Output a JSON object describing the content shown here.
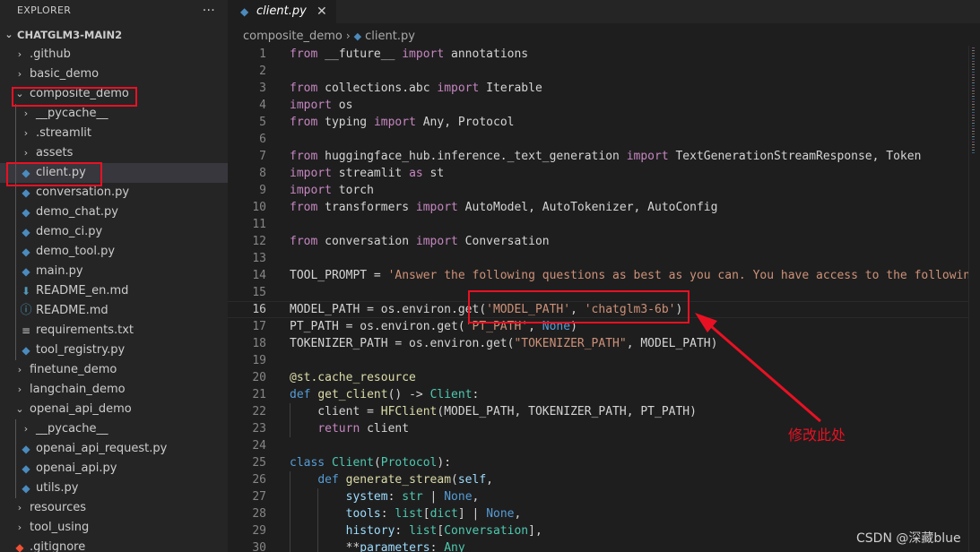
{
  "sidebar": {
    "title": "EXPLORER",
    "more": "···",
    "project": "CHATGLM3-MAIN2",
    "items": [
      {
        "label": ".github",
        "type": "folder",
        "depth": 0,
        "open": false
      },
      {
        "label": "basic_demo",
        "type": "folder",
        "depth": 0,
        "open": false
      },
      {
        "label": "composite_demo",
        "type": "folder",
        "depth": 0,
        "open": true
      },
      {
        "label": "__pycache__",
        "type": "folder",
        "depth": 1,
        "open": false
      },
      {
        "label": ".streamlit",
        "type": "folder",
        "depth": 1,
        "open": false
      },
      {
        "label": "assets",
        "type": "folder",
        "depth": 1,
        "open": false
      },
      {
        "label": "client.py",
        "type": "py",
        "depth": 1,
        "selected": true
      },
      {
        "label": "conversation.py",
        "type": "py",
        "depth": 1
      },
      {
        "label": "demo_chat.py",
        "type": "py",
        "depth": 1
      },
      {
        "label": "demo_ci.py",
        "type": "py",
        "depth": 1
      },
      {
        "label": "demo_tool.py",
        "type": "py",
        "depth": 1
      },
      {
        "label": "main.py",
        "type": "py",
        "depth": 1
      },
      {
        "label": "README_en.md",
        "type": "md",
        "depth": 1
      },
      {
        "label": "README.md",
        "type": "info",
        "depth": 1
      },
      {
        "label": "requirements.txt",
        "type": "txt",
        "depth": 1
      },
      {
        "label": "tool_registry.py",
        "type": "py",
        "depth": 1
      },
      {
        "label": "finetune_demo",
        "type": "folder",
        "depth": 0,
        "open": false
      },
      {
        "label": "langchain_demo",
        "type": "folder",
        "depth": 0,
        "open": false
      },
      {
        "label": "openai_api_demo",
        "type": "folder",
        "depth": 0,
        "open": true
      },
      {
        "label": "__pycache__",
        "type": "folder",
        "depth": 1,
        "open": false
      },
      {
        "label": "openai_api_request.py",
        "type": "py",
        "depth": 1
      },
      {
        "label": "openai_api.py",
        "type": "py",
        "depth": 1
      },
      {
        "label": "utils.py",
        "type": "py",
        "depth": 1
      },
      {
        "label": "resources",
        "type": "folder",
        "depth": 0,
        "open": false
      },
      {
        "label": "tool_using",
        "type": "folder",
        "depth": 0,
        "open": false
      },
      {
        "label": ".gitignore",
        "type": "git",
        "depth": 0
      }
    ]
  },
  "tab": {
    "label": "client.py",
    "close": "✕"
  },
  "breadcrumb": {
    "folder": "composite_demo",
    "file": "client.py"
  },
  "editor": {
    "current_line": 16,
    "lines": [
      {
        "n": 1,
        "t": [
          [
            "kw",
            "from"
          ],
          [
            "plain",
            " __future__ "
          ],
          [
            "kw",
            "import"
          ],
          [
            "plain",
            " annotations"
          ]
        ]
      },
      {
        "n": 2,
        "t": []
      },
      {
        "n": 3,
        "t": [
          [
            "kw",
            "from"
          ],
          [
            "plain",
            " collections.abc "
          ],
          [
            "kw",
            "import"
          ],
          [
            "plain",
            " Iterable"
          ]
        ]
      },
      {
        "n": 4,
        "t": [
          [
            "kw",
            "import"
          ],
          [
            "plain",
            " os"
          ]
        ]
      },
      {
        "n": 5,
        "t": [
          [
            "kw",
            "from"
          ],
          [
            "plain",
            " typing "
          ],
          [
            "kw",
            "import"
          ],
          [
            "plain",
            " Any, Protocol"
          ]
        ]
      },
      {
        "n": 6,
        "t": []
      },
      {
        "n": 7,
        "t": [
          [
            "kw",
            "from"
          ],
          [
            "plain",
            " huggingface_hub.inference._text_generation "
          ],
          [
            "kw",
            "import"
          ],
          [
            "plain",
            " TextGenerationStreamResponse, Token"
          ]
        ]
      },
      {
        "n": 8,
        "t": [
          [
            "kw",
            "import"
          ],
          [
            "plain",
            " streamlit "
          ],
          [
            "kw",
            "as"
          ],
          [
            "plain",
            " st"
          ]
        ]
      },
      {
        "n": 9,
        "t": [
          [
            "kw",
            "import"
          ],
          [
            "plain",
            " torch"
          ]
        ]
      },
      {
        "n": 10,
        "t": [
          [
            "kw",
            "from"
          ],
          [
            "plain",
            " transformers "
          ],
          [
            "kw",
            "import"
          ],
          [
            "plain",
            " AutoModel, AutoTokenizer, AutoConfig"
          ]
        ]
      },
      {
        "n": 11,
        "t": []
      },
      {
        "n": 12,
        "t": [
          [
            "kw",
            "from"
          ],
          [
            "plain",
            " conversation "
          ],
          [
            "kw",
            "import"
          ],
          [
            "plain",
            " Conversation"
          ]
        ]
      },
      {
        "n": 13,
        "t": []
      },
      {
        "n": 14,
        "t": [
          [
            "plain",
            "TOOL_PROMPT = "
          ],
          [
            "str",
            "'Answer the following questions as best as you can. You have access to the following tools:'"
          ]
        ]
      },
      {
        "n": 15,
        "t": []
      },
      {
        "n": 16,
        "t": [
          [
            "plain",
            "MODEL_PATH = os.environ.get("
          ],
          [
            "str",
            "'MODEL_PATH'"
          ],
          [
            "plain",
            ", "
          ],
          [
            "str",
            "'chatglm3-6b'"
          ],
          [
            "plain",
            ")"
          ]
        ]
      },
      {
        "n": 17,
        "t": [
          [
            "plain",
            "PT_PATH = os.environ.get("
          ],
          [
            "str",
            "'PT_PATH'"
          ],
          [
            "plain",
            ", "
          ],
          [
            "kb",
            "None"
          ],
          [
            "plain",
            ")"
          ]
        ]
      },
      {
        "n": 18,
        "t": [
          [
            "plain",
            "TOKENIZER_PATH = os.environ.get("
          ],
          [
            "str",
            "\"TOKENIZER_PATH\""
          ],
          [
            "plain",
            ", MODEL_PATH)"
          ]
        ]
      },
      {
        "n": 19,
        "t": []
      },
      {
        "n": 20,
        "t": [
          [
            "fn",
            "@st.cache_resource"
          ]
        ]
      },
      {
        "n": 21,
        "t": [
          [
            "kb",
            "def"
          ],
          [
            "plain",
            " "
          ],
          [
            "fn",
            "get_client"
          ],
          [
            "plain",
            "() -> "
          ],
          [
            "cls",
            "Client"
          ],
          [
            "plain",
            ":"
          ]
        ]
      },
      {
        "n": 22,
        "t": [
          [
            "plain",
            "    client = "
          ],
          [
            "fn",
            "HFClient"
          ],
          [
            "plain",
            "(MODEL_PATH, TOKENIZER_PATH, PT_PATH)"
          ]
        ]
      },
      {
        "n": 23,
        "t": [
          [
            "plain",
            "    "
          ],
          [
            "kw",
            "return"
          ],
          [
            "plain",
            " client"
          ]
        ]
      },
      {
        "n": 24,
        "t": []
      },
      {
        "n": 25,
        "t": [
          [
            "kb",
            "class"
          ],
          [
            "plain",
            " "
          ],
          [
            "cls",
            "Client"
          ],
          [
            "plain",
            "("
          ],
          [
            "cls",
            "Protocol"
          ],
          [
            "plain",
            "):"
          ]
        ]
      },
      {
        "n": 26,
        "t": [
          [
            "plain",
            "    "
          ],
          [
            "kb",
            "def"
          ],
          [
            "plain",
            " "
          ],
          [
            "fn",
            "generate_stream"
          ],
          [
            "plain",
            "("
          ],
          [
            "var",
            "self"
          ],
          [
            "plain",
            ","
          ]
        ]
      },
      {
        "n": 27,
        "t": [
          [
            "plain",
            "        "
          ],
          [
            "var",
            "system"
          ],
          [
            "plain",
            ": "
          ],
          [
            "cls",
            "str"
          ],
          [
            "plain",
            " | "
          ],
          [
            "kb",
            "None"
          ],
          [
            "plain",
            ","
          ]
        ]
      },
      {
        "n": 28,
        "t": [
          [
            "plain",
            "        "
          ],
          [
            "var",
            "tools"
          ],
          [
            "plain",
            ": "
          ],
          [
            "cls",
            "list"
          ],
          [
            "plain",
            "["
          ],
          [
            "cls",
            "dict"
          ],
          [
            "plain",
            "] | "
          ],
          [
            "kb",
            "None"
          ],
          [
            "plain",
            ","
          ]
        ]
      },
      {
        "n": 29,
        "t": [
          [
            "plain",
            "        "
          ],
          [
            "var",
            "history"
          ],
          [
            "plain",
            ": "
          ],
          [
            "cls",
            "list"
          ],
          [
            "plain",
            "["
          ],
          [
            "cls",
            "Conversation"
          ],
          [
            "plain",
            "],"
          ]
        ]
      },
      {
        "n": 30,
        "t": [
          [
            "plain",
            "        **"
          ],
          [
            "var",
            "parameters"
          ],
          [
            "plain",
            ": "
          ],
          [
            "cls",
            "Any"
          ]
        ]
      }
    ]
  },
  "annotation": "修改此处",
  "watermark": "CSDN @深藏blue",
  "colors": {
    "highlight": "#e81123",
    "keyword": "#c586c0",
    "string": "#ce9178"
  }
}
